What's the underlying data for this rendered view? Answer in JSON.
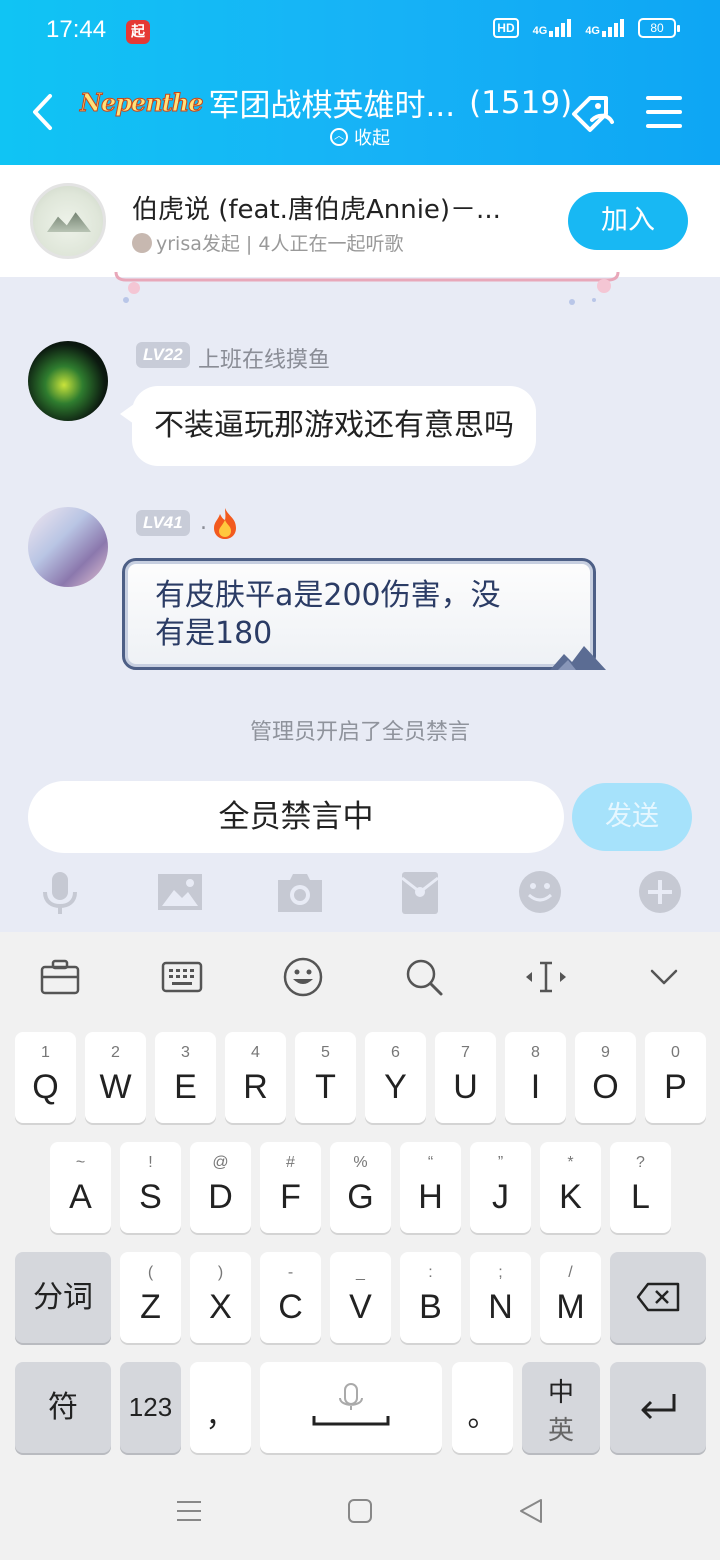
{
  "status": {
    "time": "17:44",
    "notif_badge": "起",
    "hd": "HD",
    "net1": "4G",
    "net2": "4G",
    "battery": "80"
  },
  "header": {
    "brand": "Nepenthe",
    "title": "军团战棋英雄时...",
    "member_count": "(1519)",
    "collapse_label": "收起"
  },
  "music": {
    "song": "伯虎说 (feat.唐伯虎Annie)－...",
    "meta": "yrisa发起 | 4人正在一起听歌",
    "join_label": "加入"
  },
  "messages": [
    {
      "level": "LV22",
      "nickname": "上班在线摸鱼",
      "text": "不装逼玩那游戏还有意思吗"
    },
    {
      "level": "LV41",
      "nickname": ".",
      "text_line1": "有皮肤平a是200伤害，没",
      "text_line2": "有是180"
    }
  ],
  "system_notice": "管理员开启了全员禁言",
  "input": {
    "value": "全员禁言中",
    "send_label": "发送"
  },
  "toolbar_icons": [
    "mic-icon",
    "image-icon",
    "camera-icon",
    "red-packet-icon",
    "emoji-icon",
    "plus-icon"
  ],
  "keyboard": {
    "toolbar_icons": [
      "toolbox-icon",
      "keyboard-icon",
      "emoji-icon",
      "search-icon",
      "cursor-icon",
      "collapse-icon"
    ],
    "row1": [
      {
        "sub": "1",
        "main": "Q"
      },
      {
        "sub": "2",
        "main": "W"
      },
      {
        "sub": "3",
        "main": "E"
      },
      {
        "sub": "4",
        "main": "R"
      },
      {
        "sub": "5",
        "main": "T"
      },
      {
        "sub": "6",
        "main": "Y"
      },
      {
        "sub": "7",
        "main": "U"
      },
      {
        "sub": "8",
        "main": "I"
      },
      {
        "sub": "9",
        "main": "O"
      },
      {
        "sub": "0",
        "main": "P"
      }
    ],
    "row2": [
      {
        "sub": "~",
        "main": "A"
      },
      {
        "sub": "!",
        "main": "S"
      },
      {
        "sub": "@",
        "main": "D"
      },
      {
        "sub": "#",
        "main": "F"
      },
      {
        "sub": "%",
        "main": "G"
      },
      {
        "sub": "“",
        "main": "H"
      },
      {
        "sub": "”",
        "main": "J"
      },
      {
        "sub": "*",
        "main": "K"
      },
      {
        "sub": "?",
        "main": "L"
      }
    ],
    "row3": [
      {
        "sub": "(",
        "main": "Z"
      },
      {
        "sub": ")",
        "main": "X"
      },
      {
        "sub": "-",
        "main": "C"
      },
      {
        "sub": "_",
        "main": "V"
      },
      {
        "sub": ":",
        "main": "B"
      },
      {
        "sub": ";",
        "main": "N"
      },
      {
        "sub": "/",
        "main": "M"
      }
    ],
    "fenci": "分词",
    "fu": "符",
    "num": "123",
    "comma": "，",
    "period": "。",
    "lang_top": "中",
    "lang_bottom": "英"
  }
}
